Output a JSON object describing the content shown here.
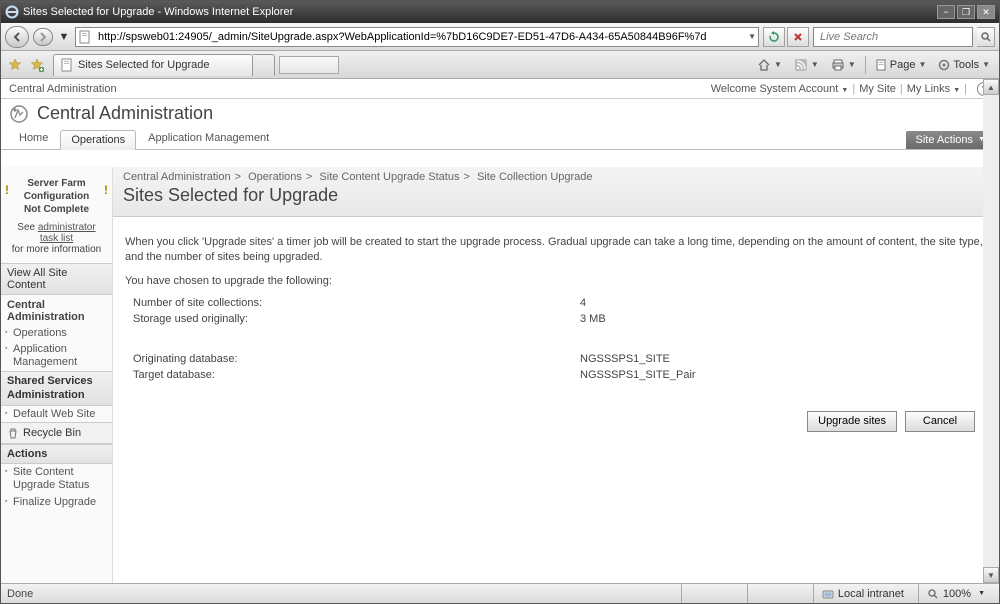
{
  "window": {
    "title": "Sites Selected for Upgrade - Windows Internet Explorer"
  },
  "address": {
    "url": "http://spsweb01:24905/_admin/SiteUpgrade.aspx?WebApplicationId=%7bD16C9DE7-ED51-47D6-A434-65A50844B96F%7d",
    "search_placeholder": "Live Search"
  },
  "tab": {
    "title": "Sites Selected for Upgrade"
  },
  "commandbar": {
    "home": "",
    "feeds": "",
    "print": "",
    "page": "Page",
    "tools": "Tools"
  },
  "userbar": {
    "left": "Central Administration",
    "welcome": "Welcome System Account",
    "mysite": "My Site",
    "mylinks": "My Links"
  },
  "sp_title": "Central Administration",
  "sp_tabs": {
    "home": "Home",
    "operations": "Operations",
    "appmgmt": "Application Management"
  },
  "site_actions": "Site Actions",
  "left_nav": {
    "warn_line1": "Server Farm",
    "warn_line2": "Configuration",
    "warn_line3": "Not Complete",
    "warn_see": "See ",
    "warn_link": "administrator task list",
    "warn_more": "for more information",
    "view_all": "View All Site Content",
    "central_admin": "Central Administration",
    "operations": "Operations",
    "appmgmt": "Application Management",
    "shared_head": "Shared Services Administration",
    "default_site": "Default Web Site",
    "recycle": "Recycle Bin",
    "actions_head": "Actions",
    "action1": "Site Content Upgrade Status",
    "action2": "Finalize Upgrade"
  },
  "breadcrumb": {
    "a": "Central Administration",
    "b": "Operations",
    "c": "Site Content Upgrade Status",
    "d": "Site Collection Upgrade"
  },
  "page_heading": "Sites Selected for Upgrade",
  "content": {
    "intro": "When you click 'Upgrade sites' a timer job will be created to start the upgrade process. Gradual upgrade can take a long time, depending on the amount of content, the site type, and the number of sites being upgraded.",
    "chosen": "You have chosen to upgrade the following:",
    "rows": {
      "k1": "Number of site collections:",
      "v1": "4",
      "k2": "Storage used originally:",
      "v2": "3 MB",
      "k3": "Originating database:",
      "v3": "NGSSSPS1_SITE",
      "k4": "Target database:",
      "v4": "NGSSSPS1_SITE_Pair"
    },
    "btn_upgrade": "Upgrade sites",
    "btn_cancel": "Cancel"
  },
  "statusbar": {
    "done": "Done",
    "zone": "Local intranet",
    "zoom": "100%"
  }
}
